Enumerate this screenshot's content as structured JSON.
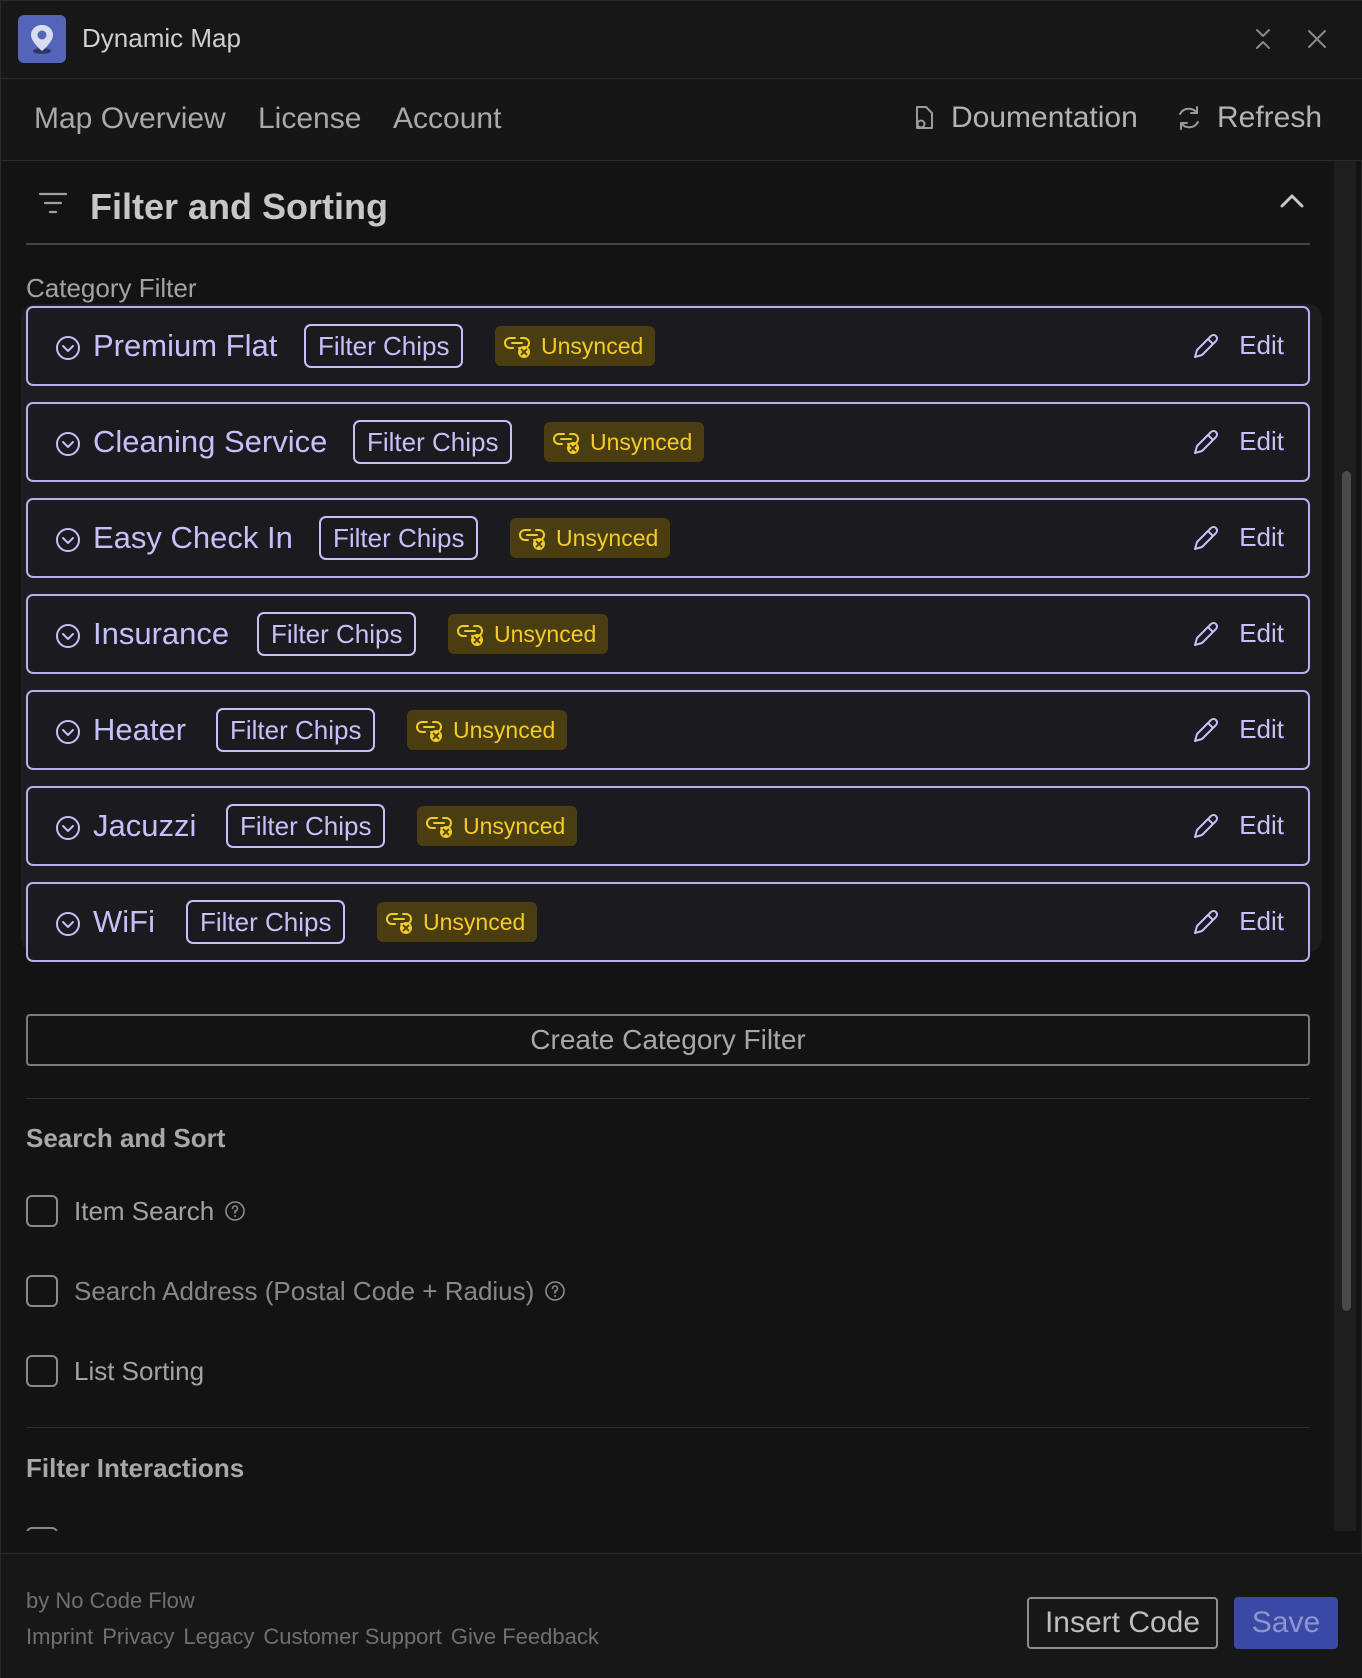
{
  "window": {
    "title": "Dynamic Map",
    "icons": {
      "app": "map-pin-icon",
      "collapse": "collapse-window-icon",
      "close": "close-icon"
    }
  },
  "nav": {
    "tabs": [
      "Map Overview",
      "License",
      "Account"
    ],
    "documentation_label": "Doumentation",
    "refresh_label": "Refresh"
  },
  "filter_section": {
    "title": "Filter and Sorting",
    "category_filter_label": "Category Filter",
    "categories": [
      {
        "name": "Premium Flat",
        "chip": "Filter Chips",
        "status": "Unsynced",
        "action": "Edit"
      },
      {
        "name": "Cleaning Service",
        "chip": "Filter Chips",
        "status": "Unsynced",
        "action": "Edit"
      },
      {
        "name": "Easy Check In",
        "chip": "Filter Chips",
        "status": "Unsynced",
        "action": "Edit"
      },
      {
        "name": "Insurance",
        "chip": "Filter Chips",
        "status": "Unsynced",
        "action": "Edit"
      },
      {
        "name": "Heater",
        "chip": "Filter Chips",
        "status": "Unsynced",
        "action": "Edit"
      },
      {
        "name": "Jacuzzi",
        "chip": "Filter Chips",
        "status": "Unsynced",
        "action": "Edit"
      },
      {
        "name": "WiFi",
        "chip": "Filter Chips",
        "status": "Unsynced",
        "action": "Edit"
      }
    ],
    "create_button": "Create Category Filter"
  },
  "search_sort": {
    "title": "Search and Sort",
    "options": [
      {
        "label": "Item Search",
        "checked": false,
        "help": true
      },
      {
        "label": "Search Address (Postal Code + Radius)",
        "checked": false,
        "help": true
      },
      {
        "label": "List Sorting",
        "checked": false,
        "help": false
      }
    ]
  },
  "filter_interactions": {
    "title": "Filter Interactions"
  },
  "footer": {
    "byline": "by No Code Flow",
    "links": [
      "Imprint",
      "Privacy",
      "Legacy",
      "Customer Support",
      "Give Feedback"
    ],
    "insert_code": "Insert Code",
    "save": "Save"
  },
  "colors": {
    "background": "#131313",
    "accent": "#c6c0fa",
    "warning_text": "#f2cc28",
    "warning_bg": "#4b3d12",
    "primary": "#3a49a6"
  }
}
